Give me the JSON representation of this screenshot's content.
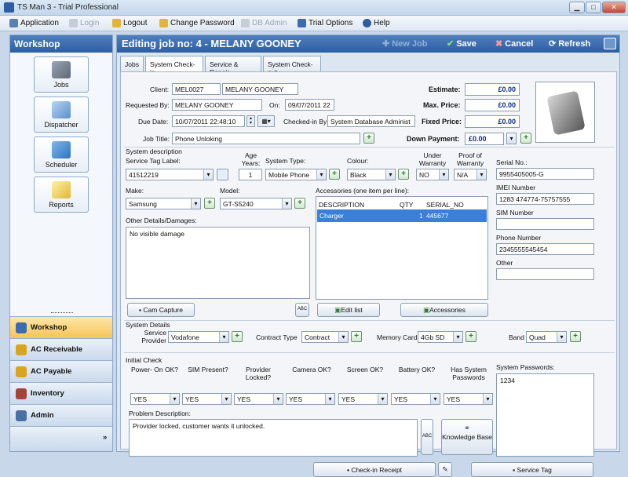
{
  "window": {
    "title": "TS Man 3 - Trial Professional",
    "min": "▁",
    "max": "□",
    "close": "✕"
  },
  "menu": {
    "application": "Application",
    "login": "Login",
    "logout": "Logout",
    "change_password": "Change Password",
    "db_admin": "DB Admin",
    "trial_options": "Trial Options",
    "help": "Help"
  },
  "sidebar": {
    "title": "Workshop",
    "buttons": [
      "Jobs",
      "Dispatcher",
      "Scheduler",
      "Reports"
    ],
    "nav": [
      "Workshop",
      "AC Receivable",
      "AC Payable",
      "Inventory",
      "Admin"
    ],
    "more": "»"
  },
  "header": {
    "title": "Editing job no: 4 - MELANY GOONEY",
    "new_job": "New Job",
    "save": "Save",
    "cancel": "Cancel",
    "refresh": "Refresh"
  },
  "tabs": [
    "Jobs",
    "System Check-in",
    "Service & Repair",
    "System Check-out"
  ],
  "checkin": {
    "client_label": "Client:",
    "client_code": "MEL0027",
    "client_name": "MELANY GOONEY",
    "requested_by_label": "Requested By:",
    "requested_by": "MELANY  GOONEY",
    "on_label": "On:",
    "on_date": "09/07/2011 22",
    "due_date_label": "Due Date:",
    "due_date": "10/07/2011 22:48:10",
    "checked_in_by_label": "Checked-in By:",
    "checked_in_by": "System Database Administ",
    "job_title_label": "Job Title:",
    "job_title": "Phone Unloking",
    "estimate_label": "Estimate:",
    "estimate": "£0.00",
    "max_price_label": "Max. Price:",
    "max_price": "£0.00",
    "fixed_price_label": "Fixed Price:",
    "fixed_price": "£0.00",
    "down_payment_label": "Down Payment:",
    "down_payment": "£0.00"
  },
  "system": {
    "section": "System description",
    "tag_label": "Service Tag Label:",
    "tag": "41512219",
    "age_label": "Age Years:",
    "age": "1",
    "type_label": "System Type:",
    "type": "Mobile Phone",
    "colour_label": "Colour:",
    "colour": "Black",
    "under_warranty_label": "Under Warranty",
    "under_warranty": "NO",
    "proof_label": "Proof of Warranty",
    "proof": "N/A",
    "make_label": "Make:",
    "make": "Samsung",
    "model_label": "Model:",
    "model": "GT-S5240",
    "accessories_label": "Accessories (one item per line):",
    "acc_headers": [
      "DESCRIPTION",
      "QTY",
      "SERIAL_NO"
    ],
    "acc_row": [
      "Charger",
      "1",
      "445677"
    ],
    "other_label": "Other Details/Damages:",
    "other": "No visible damage",
    "cam_capture": "Cam Capture",
    "edit_list": "Edit list",
    "accessories_btn": "Accessories",
    "serial_label": "Serial No.:",
    "serial": "9955405005-G",
    "imei_label": "IMEI Number",
    "imei": "1283 474774-75757555",
    "sim_label": "SIM Number",
    "sim": "",
    "phone_label": "Phone Number",
    "phone": "2345555545454",
    "other2_label": "Other",
    "other2": ""
  },
  "details": {
    "section": "System Details",
    "provider_label": "Service Provider",
    "provider": "Vodafone",
    "contract_label": "Contract Type",
    "contract": "Contract",
    "memory_label": "Memory Card",
    "memory": "4Gb SD",
    "band_label": "Band",
    "band": "Quad"
  },
  "initial": {
    "section": "Initial Check",
    "checks": [
      "Power- On OK?",
      "SIM Present?",
      "Provider Locked?",
      "Camera OK?",
      "Screen OK?",
      "Battery OK?",
      "Has System Passwords"
    ],
    "values": [
      "YES",
      "YES",
      "YES",
      "YES",
      "YES",
      "YES",
      "YES"
    ],
    "passwords_label": "System Passwords:",
    "passwords": "1234",
    "problem_label": "Problem Description:",
    "problem": "Provider locked, customer wants it unlocked.",
    "kb": "Knowledge Base",
    "checkin_receipt": "Check-in Receipt",
    "service_tag": "Service Tag",
    "abc": "ABC"
  }
}
